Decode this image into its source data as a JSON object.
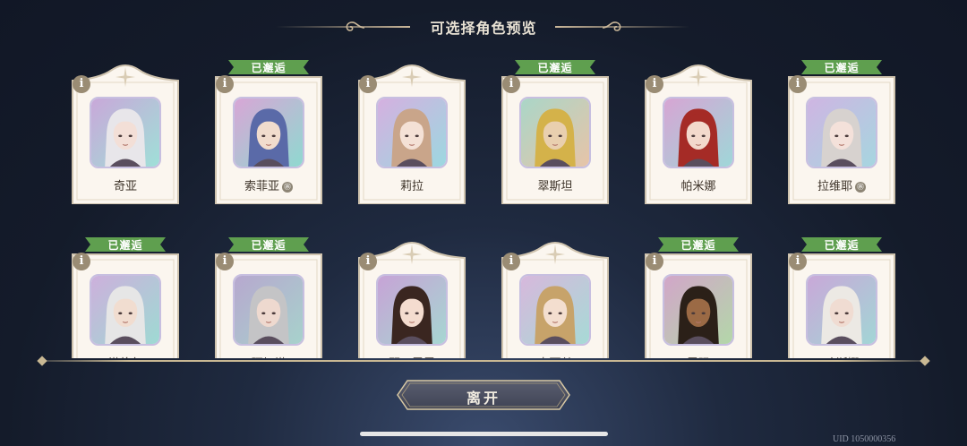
{
  "header": {
    "title": "可选择角色预览"
  },
  "badge_label": "已邂逅",
  "info_label": "i",
  "fav_label": "㊪",
  "characters_row1": [
    {
      "name": "奇亚",
      "met": false,
      "fav": false,
      "hair": "#e8e6ea",
      "skin": "#f3dfd7",
      "bg1": "#c9a8d9",
      "bg2": "#9fe0d8"
    },
    {
      "name": "索菲亚",
      "met": true,
      "fav": true,
      "hair": "#5a6aa8",
      "skin": "#f1dccd",
      "bg1": "#d8a6d6",
      "bg2": "#8fd9d0"
    },
    {
      "name": "莉拉",
      "met": false,
      "fav": false,
      "hair": "#c9a58a",
      "skin": "#f4e1d6",
      "bg1": "#d5b0e0",
      "bg2": "#9cd8e0"
    },
    {
      "name": "翠斯坦",
      "met": true,
      "fav": false,
      "hair": "#d4b24a",
      "skin": "#e9cfaf",
      "bg1": "#aad6c8",
      "bg2": "#e7c4a8"
    },
    {
      "name": "帕米娜",
      "met": false,
      "fav": false,
      "hair": "#a52b26",
      "skin": "#f3d9cc",
      "bg1": "#d7a5d4",
      "bg2": "#9fd7d8"
    },
    {
      "name": "拉维耶",
      "met": true,
      "fav": true,
      "hair": "#d7d2cf",
      "skin": "#f4e1da",
      "bg1": "#cfb5e2",
      "bg2": "#a6d6e0"
    }
  ],
  "characters_row2": [
    {
      "name": "塔伦尔",
      "met": true,
      "fav": false,
      "hair": "#e6e6e6",
      "skin": "#f1ddd0",
      "bg1": "#cdb0dc",
      "bg2": "#9edad3"
    },
    {
      "name": "阿加塔",
      "met": true,
      "fav": false,
      "hair": "#c4c4c6",
      "skin": "#eed9cf",
      "bg1": "#b7a8cf",
      "bg2": "#a7d2cc"
    },
    {
      "name": "瑟可露露",
      "met": false,
      "fav": false,
      "hair": "#3a2620",
      "skin": "#f4dccf",
      "bg1": "#c7a3d6",
      "bg2": "#a6d7d2"
    },
    {
      "name": "卡丽丝",
      "met": false,
      "fav": false,
      "hair": "#c7a36a",
      "skin": "#f3decf",
      "bg1": "#d7b8dc",
      "bg2": "#a7dad6"
    },
    {
      "name": "露玛",
      "met": true,
      "fav": false,
      "hair": "#2b2018",
      "skin": "#9b6a45",
      "bg1": "#d2a6c9",
      "bg2": "#b3d7a9"
    },
    {
      "name": "哈斯娜",
      "met": true,
      "fav": false,
      "hair": "#ece9e4",
      "skin": "#f0dcd2",
      "bg1": "#c9a8d8",
      "bg2": "#a2d6d6"
    }
  ],
  "leave_button": {
    "label": "离开"
  },
  "uid": "UID 1050000356",
  "colors": {
    "ribbon": "#5f9f4f",
    "card": "#fbf6ef",
    "card_border": "#cfc3ae",
    "button": "#4b4f60"
  }
}
